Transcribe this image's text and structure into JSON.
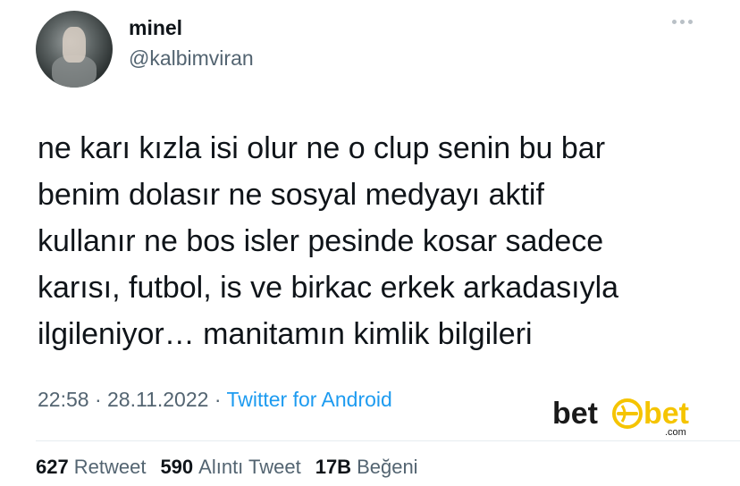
{
  "author": {
    "name": "minel",
    "handle": "@kalbimviran"
  },
  "tweet": {
    "lines": [
      "ne karı kızla isi olur ne o clup senin bu bar",
      "benim dolasır ne sosyal medyayı aktif",
      "kullanır ne bos isler pesinde kosar sadece",
      "karısı, futbol, is ve birkac erkek arkadasıyla",
      "ilgileniyor… manitamın kimlik bilgileri"
    ],
    "time": "22:58",
    "separator": "·",
    "date": "28.11.2022",
    "source": "Twitter for Android"
  },
  "watermark": {
    "brand_left": "bet",
    "brand_right": "bet",
    "suffix": ".com",
    "accent": "#f5c400"
  },
  "stats": {
    "retweets_count": "627",
    "retweets_label": "Retweet",
    "quotes_count": "590",
    "quotes_label": "Alıntı Tweet",
    "likes_count": "17B",
    "likes_label": "Beğeni"
  },
  "colors": {
    "text": "#0f1419",
    "secondary": "#536471",
    "link": "#1d9bf0"
  },
  "icons": {
    "avatar": "profile-photo",
    "more": "more-horizontal-icon"
  }
}
